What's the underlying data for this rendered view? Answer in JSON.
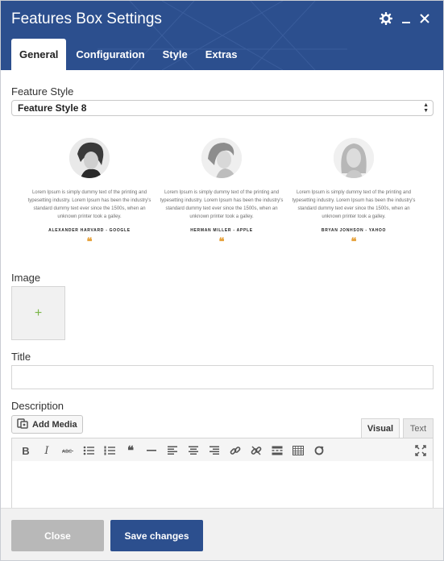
{
  "dialog": {
    "title": "Features Box Settings",
    "icons": [
      "gear-icon",
      "minimize-icon",
      "close-icon"
    ],
    "colors": {
      "header": "#2c4f8e",
      "accent_quote": "#e6a23c",
      "plus": "#7ab648"
    }
  },
  "tabs": [
    {
      "label": "General",
      "active": true
    },
    {
      "label": "Configuration",
      "active": false
    },
    {
      "label": "Style",
      "active": false
    },
    {
      "label": "Extras",
      "active": false
    }
  ],
  "feature_style": {
    "label": "Feature Style",
    "selected": "Feature Style 8"
  },
  "previews": [
    {
      "text": "Lorem Ipsum is simply dummy text of the printing and typesetting industry. Lorem Ipsum has been the industry's standard dummy text ever since the 1500s, when an unknown printer took a galley.",
      "name": "ALEXANDER HARVARD - GOOGLE",
      "quote": "❝"
    },
    {
      "text": "Lorem Ipsum is simply dummy text of the printing and typesetting industry. Lorem Ipsum has been the industry's standard dummy text ever since the 1500s, when an unknown printer took a galley.",
      "name": "HERMAN MILLER - APPLE",
      "quote": "❝"
    },
    {
      "text": "Lorem Ipsum is simply dummy text of the printing and typesetting industry. Lorem Ipsum has been the industry's standard dummy text ever since the 1500s, when an unknown printer took a galley.",
      "name": "BRYAN JONHSON - YAHOO",
      "quote": "❝"
    }
  ],
  "image": {
    "label": "Image",
    "plus": "+"
  },
  "title_field": {
    "label": "Title",
    "value": "",
    "placeholder": ""
  },
  "description": {
    "label": "Description",
    "add_media": "Add Media",
    "tab_visual": "Visual",
    "tab_text": "Text",
    "toolbar": [
      "bold",
      "italic",
      "strikethrough",
      "bulleted-list",
      "numbered-list",
      "blockquote",
      "horizontal-line",
      "align-left",
      "align-center",
      "align-right",
      "insert-link",
      "remove-link",
      "read-more",
      "toolbar-toggle",
      "refresh",
      "fullscreen"
    ]
  },
  "footer": {
    "close_label": "Close",
    "save_label": "Save changes"
  }
}
